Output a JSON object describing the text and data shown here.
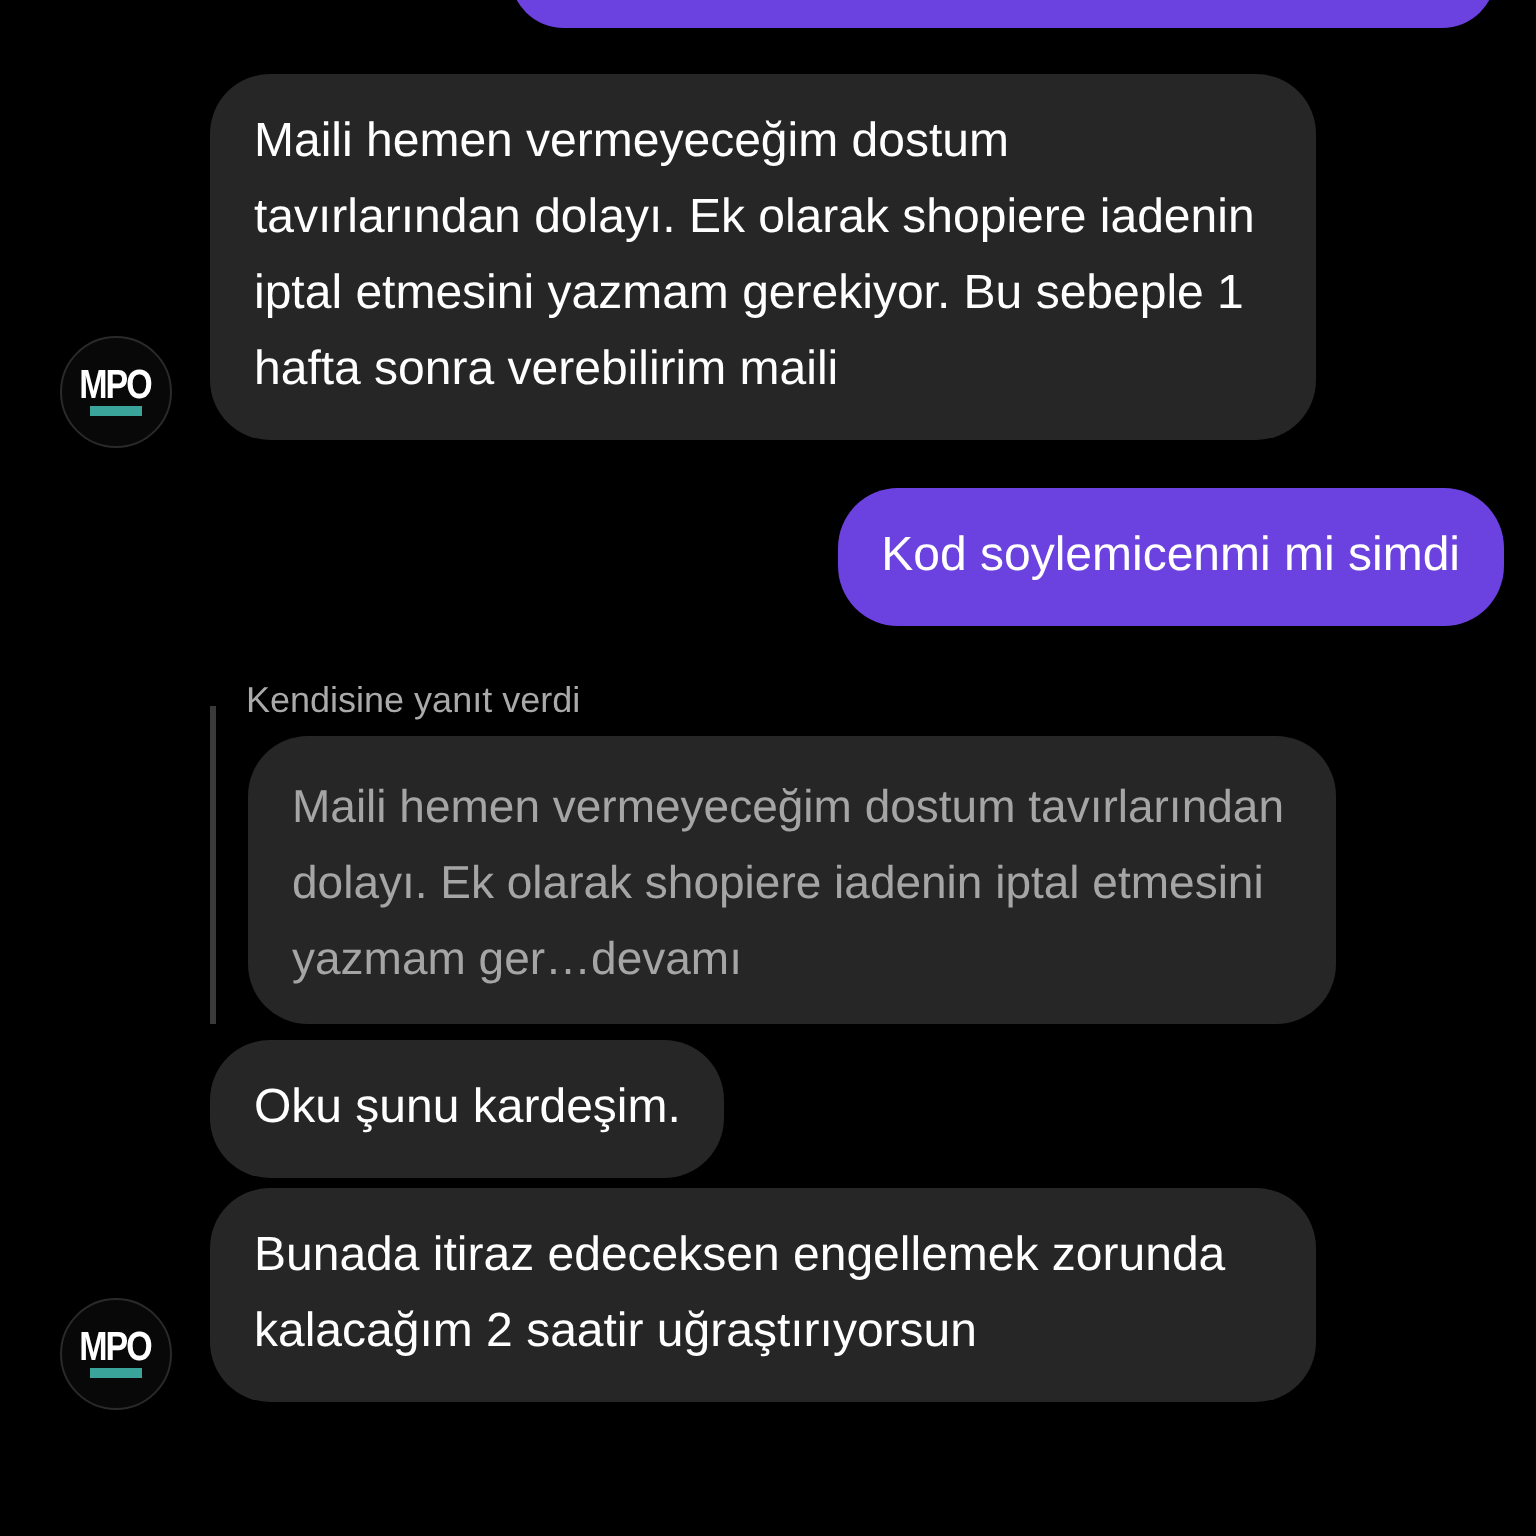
{
  "messages": [
    {
      "kind": "clipped_sent"
    },
    {
      "kind": "received",
      "text": "Maili hemen vermeyeceğim dostum tavırlarından dolayı. Ek olarak shopiere iadenin iptal etmesini yazmam gerekiyor. Bu sebeple 1 hafta sonra verebilirim maili",
      "avatar": "MPO"
    },
    {
      "kind": "sent",
      "text": "Kod soylemicenmi mi simdi"
    },
    {
      "kind": "reply",
      "label": "Kendisine yanıt verdi",
      "quote": "Maili hemen vermeyeceğim dostum tavırlarından dolayı. Ek olarak shopiere iadenin iptal etmesini yazmam ger…devamı"
    },
    {
      "kind": "received",
      "text": "Oku şunu kardeşim."
    },
    {
      "kind": "received",
      "text": "Bunada itiraz edeceksen engellemek zorunda kalacağım 2 saatir uğraştırıyorsun",
      "avatar": "MPO"
    }
  ]
}
